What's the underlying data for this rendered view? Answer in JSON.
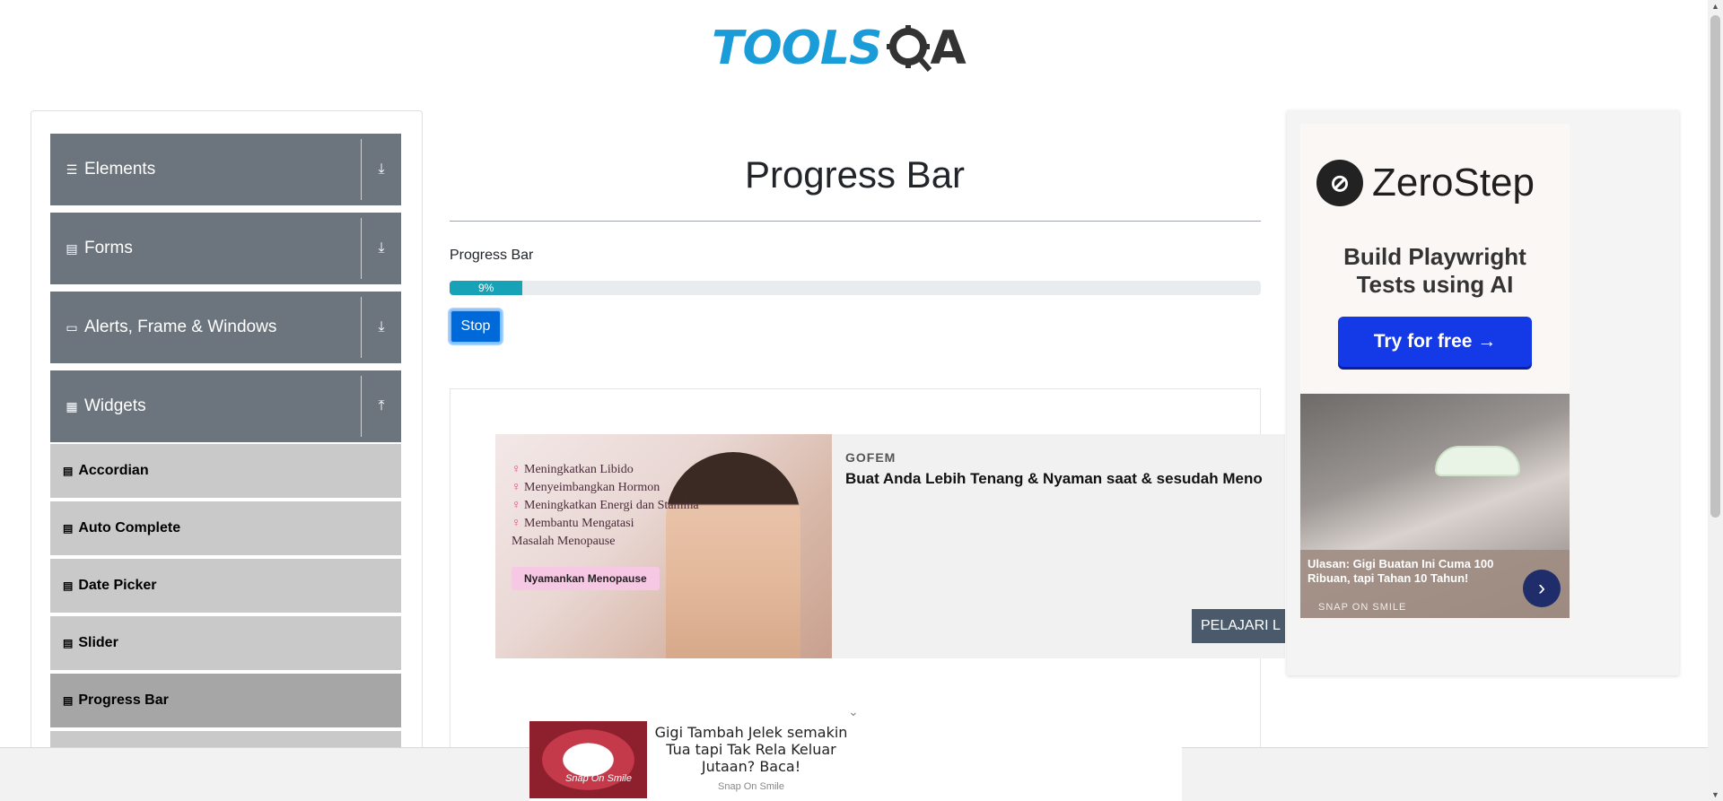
{
  "logo": {
    "text": "TOOLS",
    "q": "Q",
    "a": "A"
  },
  "sidebar": {
    "groups": [
      {
        "label": "Elements",
        "icon": "hamburger-icon",
        "glyph": "☰",
        "arrow": "⤓"
      },
      {
        "label": "Forms",
        "icon": "form-icon",
        "glyph": "▤",
        "arrow": "⤓"
      },
      {
        "label": "Alerts, Frame & Windows",
        "icon": "window-icon",
        "glyph": "▭",
        "arrow": "⤓"
      },
      {
        "label": "Widgets",
        "icon": "widgets-icon",
        "glyph": "▦",
        "arrow": "⤒"
      }
    ],
    "items": [
      {
        "label": "Accordian"
      },
      {
        "label": "Auto Complete"
      },
      {
        "label": "Date Picker"
      },
      {
        "label": "Slider"
      },
      {
        "label": "Progress Bar",
        "active": true
      }
    ],
    "item_glyph": "▤"
  },
  "main": {
    "title": "Progress Bar",
    "label": "Progress Bar",
    "progress": {
      "value": 9,
      "text": "9%"
    },
    "stop_label": "Stop"
  },
  "ad_banner": {
    "bullets": [
      "Meningkatkan Libido",
      "Menyeimbangkan Hormon",
      "Meningkatkan Energi dan Stamina",
      "Membantu Mengatasi Masalah Menopause"
    ],
    "pill": "Nyamankan Menopause",
    "brand": "GOFEM",
    "headline": "Buat Anda Lebih Tenang & Nyaman saat & sesudah Meno",
    "cta": "PELAJARI L",
    "chevron": "⌄"
  },
  "right_ad": {
    "logo_mark": "⊘",
    "name": "ZeroStep",
    "tagline_1": "Build Playwright",
    "tagline_2": "Tests using AI",
    "button": "Try for free →",
    "caption": "Ulasan: Gigi Buatan Ini Cuma 100 Ribuan, tapi Tahan 10 Tahun!",
    "brand": "SNAP ON SMILE",
    "arrow": "›"
  },
  "bottom_ad": {
    "text": "Gigi Tambah Jelek semakin Tua tapi Tak Rela Keluar Jutaan? Baca!",
    "brand": "Snap On Smile",
    "img_label": "Snap On Smile"
  },
  "scroll": {
    "up": "▲",
    "down": "▼"
  },
  "colors": {
    "logo_blue": "#1a9cd8",
    "sidebar_group": "#6c757d",
    "progress": "#17a2b8",
    "button": "#0069d9"
  }
}
